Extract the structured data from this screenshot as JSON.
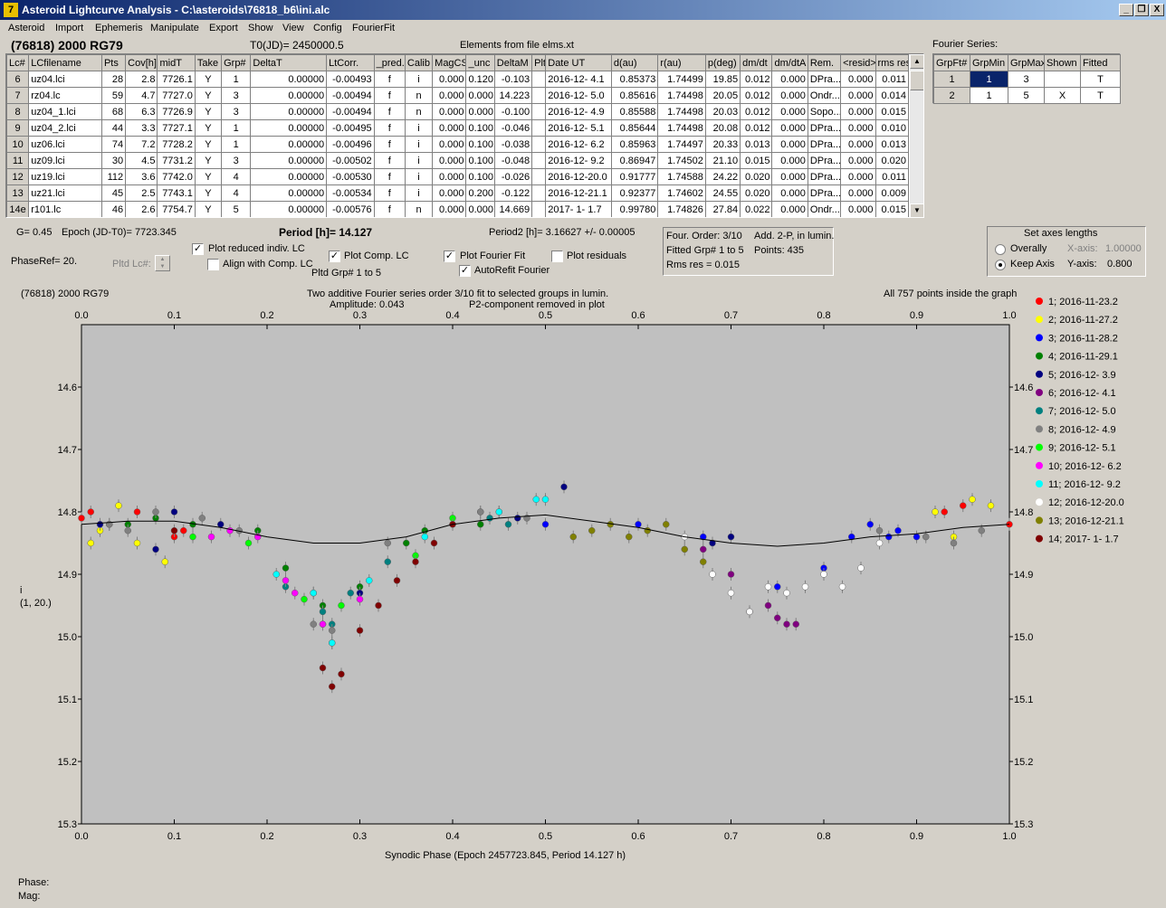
{
  "window": {
    "title": "Asteroid Lightcurve Analysis - C:\\asteroids\\76818_b6\\ini.alc",
    "min": "_",
    "restore": "❐",
    "close": "X"
  },
  "menu": [
    "Asteroid",
    "Import",
    "Ephemeris",
    "Manipulate",
    "Export",
    "Show",
    "View",
    "Config",
    "FourierFit"
  ],
  "header": {
    "object": "(76818) 2000 RG79",
    "t0": "T0(JD)= 2450000.5",
    "elements": "Elements from file elms.xt",
    "fourier_label": "Fourier Series:"
  },
  "lc_table": {
    "columns": [
      "Lc#",
      "LCfilename",
      "Pts",
      "Cov[h]",
      "midT",
      "Take",
      "Grp#",
      "DeltaT",
      "LtCorr.",
      "_pred.",
      "Calib",
      "MagCS",
      "_unc",
      "DeltaM",
      "Plt",
      "Date UT",
      "d(au)",
      "r(au)",
      "p(deg)",
      "dm/dt",
      "dm/dtA",
      "Rem.",
      "<resid>",
      "rms res"
    ],
    "rows": [
      [
        "6",
        "uz04.lci",
        "28",
        "2.8",
        "7726.1",
        "Y",
        "1",
        "0.00000",
        "-0.00493",
        "f",
        "i",
        "0.000",
        "0.120",
        "-0.103",
        "",
        "2016-12- 4.1",
        "0.85373",
        "1.74499",
        "19.85",
        "0.012",
        "0.000",
        "DPra...",
        "0.000",
        "0.011"
      ],
      [
        "7",
        "rz04.lc",
        "59",
        "4.7",
        "7727.0",
        "Y",
        "3",
        "0.00000",
        "-0.00494",
        "f",
        "n",
        "0.000",
        "0.000",
        "14.223",
        "",
        "2016-12- 5.0",
        "0.85616",
        "1.74498",
        "20.05",
        "0.012",
        "0.000",
        "Ondr...",
        "0.000",
        "0.014"
      ],
      [
        "8",
        "uz04_1.lci",
        "68",
        "6.3",
        "7726.9",
        "Y",
        "3",
        "0.00000",
        "-0.00494",
        "f",
        "n",
        "0.000",
        "0.000",
        "-0.100",
        "",
        "2016-12- 4.9",
        "0.85588",
        "1.74498",
        "20.03",
        "0.012",
        "0.000",
        "Sopo...",
        "0.000",
        "0.015"
      ],
      [
        "9",
        "uz04_2.lci",
        "44",
        "3.3",
        "7727.1",
        "Y",
        "1",
        "0.00000",
        "-0.00495",
        "f",
        "i",
        "0.000",
        "0.100",
        "-0.046",
        "",
        "2016-12- 5.1",
        "0.85644",
        "1.74498",
        "20.08",
        "0.012",
        "0.000",
        "DPra...",
        "0.000",
        "0.010"
      ],
      [
        "10",
        "uz06.lci",
        "74",
        "7.2",
        "7728.2",
        "Y",
        "1",
        "0.00000",
        "-0.00496",
        "f",
        "i",
        "0.000",
        "0.100",
        "-0.038",
        "",
        "2016-12- 6.2",
        "0.85963",
        "1.74497",
        "20.33",
        "0.013",
        "0.000",
        "DPra...",
        "0.000",
        "0.013"
      ],
      [
        "11",
        "uz09.lci",
        "30",
        "4.5",
        "7731.2",
        "Y",
        "3",
        "0.00000",
        "-0.00502",
        "f",
        "i",
        "0.000",
        "0.100",
        "-0.048",
        "",
        "2016-12- 9.2",
        "0.86947",
        "1.74502",
        "21.10",
        "0.015",
        "0.000",
        "DPra...",
        "0.000",
        "0.020"
      ],
      [
        "12",
        "uz19.lci",
        "112",
        "3.6",
        "7742.0",
        "Y",
        "4",
        "0.00000",
        "-0.00530",
        "f",
        "i",
        "0.000",
        "0.100",
        "-0.026",
        "",
        "2016-12-20.0",
        "0.91777",
        "1.74588",
        "24.22",
        "0.020",
        "0.000",
        "DPra...",
        "0.000",
        "0.011"
      ],
      [
        "13",
        "uz21.lci",
        "45",
        "2.5",
        "7743.1",
        "Y",
        "4",
        "0.00000",
        "-0.00534",
        "f",
        "i",
        "0.000",
        "0.200",
        "-0.122",
        "",
        "2016-12-21.1",
        "0.92377",
        "1.74602",
        "24.55",
        "0.020",
        "0.000",
        "DPra...",
        "0.000",
        "0.009"
      ],
      [
        "14e",
        "r101.lc",
        "46",
        "2.6",
        "7754.7",
        "Y",
        "5",
        "0.00000",
        "-0.00576",
        "f",
        "n",
        "0.000",
        "0.000",
        "14.669",
        "",
        "2017- 1- 1.7",
        "0.99780",
        "1.74826",
        "27.84",
        "0.022",
        "0.000",
        "Ondr...",
        "0.000",
        "0.015"
      ]
    ]
  },
  "fourier_table": {
    "columns": [
      "GrpFt#",
      "GrpMin",
      "GrpMax",
      "Shown",
      "Fitted"
    ],
    "rows": [
      [
        "1",
        "1",
        "3",
        "",
        "T"
      ],
      [
        "2",
        "1",
        "5",
        "X",
        "T"
      ]
    ]
  },
  "controls": {
    "g": "G= 0.45",
    "epoch": "Epoch (JD-T0)= 7723.345",
    "period": "Period [h]= 14.127",
    "period2": "Period2 [h]= 3.16627 +/- 0.00005",
    "phaseref": "PhaseRef= 20.",
    "pltd_lc": "Pltd Lc#:",
    "plot_reduced": "Plot reduced indiv. LC",
    "align_comp": "Align with Comp. LC",
    "plot_comp": "Plot Comp. LC",
    "pltd_grp": "Pltd Grp#  1   to   5",
    "plot_fourier": "Plot Fourier Fit",
    "autorefit": "AutoRefit Fourier",
    "plot_residuals": "Plot residuals",
    "info1a": "Four. Order:  3/10",
    "info1b": "Add. 2-P, in lumin.",
    "info2a": "Fitted Grp# 1 to 5",
    "info2b": "Points: 435",
    "info3": "Rms res     = 0.015",
    "axes_title": "Set axes lengths",
    "overally": "Overally",
    "keep_axis": "Keep Axis",
    "xaxis_lbl": "X-axis:",
    "xaxis_val": "1.00000",
    "yaxis_lbl": "Y-axis:",
    "yaxis_val": "0.800"
  },
  "plot": {
    "object": "(76818) 2000 RG79",
    "title1": "Two additive Fourier series order 3/10 fit to selected groups in lumin.",
    "title2": "Amplitude: 0.043",
    "title3": "P2-component removed in plot",
    "points_note": "All 757 points inside the graph",
    "ylabel1": "i",
    "ylabel2": "(1, 20.)",
    "xlabel": "Synodic Phase (Epoch 2457723.845, Period 14.127 h)"
  },
  "status": {
    "phase": "Phase:",
    "mag": "Mag:"
  },
  "colors": {
    "panel": "#d4d0c8",
    "plot_bg": "#c0c0c0",
    "selected": "#0a246a"
  },
  "chart_data": {
    "type": "scatter",
    "xlabel": "Synodic Phase (Epoch 2457723.845, Period 14.127 h)",
    "ylabel": "i",
    "xlim": [
      0.0,
      1.0
    ],
    "ylim": [
      15.3,
      14.5
    ],
    "xticks": [
      "0.0",
      "0.1",
      "0.2",
      "0.3",
      "0.4",
      "0.5",
      "0.6",
      "0.7",
      "0.8",
      "0.9",
      "1.0"
    ],
    "yticks": [
      "14.6",
      "14.7",
      "14.8",
      "14.9",
      "15.0",
      "15.1",
      "15.2",
      "15.3"
    ],
    "fourier_fit": {
      "x": [
        0.0,
        0.05,
        0.1,
        0.15,
        0.2,
        0.25,
        0.3,
        0.35,
        0.4,
        0.45,
        0.5,
        0.55,
        0.6,
        0.65,
        0.7,
        0.75,
        0.8,
        0.85,
        0.9,
        0.95,
        1.0
      ],
      "y": [
        14.82,
        14.815,
        14.815,
        14.825,
        14.84,
        14.85,
        14.85,
        14.84,
        14.82,
        14.81,
        14.805,
        14.815,
        14.825,
        14.84,
        14.85,
        14.855,
        14.85,
        14.84,
        14.835,
        14.825,
        14.82
      ]
    },
    "series": [
      {
        "name": "1; 2016-11-23.2",
        "color": "#ff0000",
        "x": [
          0.0,
          0.01,
          0.03,
          0.06,
          0.1,
          0.11,
          1.0,
          0.95,
          0.93
        ],
        "y": [
          14.81,
          14.8,
          14.82,
          14.8,
          14.84,
          14.83,
          14.82,
          14.79,
          14.8
        ]
      },
      {
        "name": "2; 2016-11-27.2",
        "color": "#ffff00",
        "x": [
          0.01,
          0.02,
          0.04,
          0.06,
          0.09,
          0.92,
          0.94,
          0.96,
          0.98
        ],
        "y": [
          14.85,
          14.83,
          14.79,
          14.85,
          14.88,
          14.8,
          14.84,
          14.78,
          14.79
        ]
      },
      {
        "name": "3; 2016-11-28.2",
        "color": "#0000ff",
        "x": [
          0.45,
          0.5,
          0.6,
          0.67,
          0.75,
          0.8,
          0.83,
          0.85,
          0.87,
          0.88,
          0.9
        ],
        "y": [
          14.8,
          14.82,
          14.82,
          14.84,
          14.92,
          14.89,
          14.84,
          14.82,
          14.84,
          14.83,
          14.84
        ]
      },
      {
        "name": "4; 2016-11-29.1",
        "color": "#008000",
        "x": [
          0.05,
          0.08,
          0.12,
          0.19,
          0.22,
          0.26,
          0.3,
          0.35,
          0.37,
          0.43
        ],
        "y": [
          14.82,
          14.81,
          14.82,
          14.83,
          14.89,
          14.95,
          14.92,
          14.85,
          14.83,
          14.82
        ]
      },
      {
        "name": "5; 2016-12- 3.9",
        "color": "#000080",
        "x": [
          0.02,
          0.08,
          0.1,
          0.15,
          0.27,
          0.3,
          0.4,
          0.43,
          0.47,
          0.52,
          0.68,
          0.7
        ],
        "y": [
          14.82,
          14.86,
          14.8,
          14.82,
          15.01,
          14.93,
          14.82,
          14.8,
          14.81,
          14.76,
          14.85,
          14.84
        ]
      },
      {
        "name": "6; 2016-12- 4.1",
        "color": "#800080",
        "x": [
          0.67,
          0.7,
          0.72,
          0.74,
          0.75,
          0.76,
          0.77
        ],
        "y": [
          14.86,
          14.9,
          14.96,
          14.95,
          14.97,
          14.98,
          14.98
        ]
      },
      {
        "name": "7; 2016-12- 5.0",
        "color": "#008080",
        "x": [
          0.22,
          0.26,
          0.27,
          0.29,
          0.33,
          0.44,
          0.46
        ],
        "y": [
          14.92,
          14.96,
          14.98,
          14.93,
          14.88,
          14.81,
          14.82
        ]
      },
      {
        "name": "8; 2016-12- 4.9",
        "color": "#808080",
        "x": [
          0.03,
          0.05,
          0.08,
          0.13,
          0.17,
          0.25,
          0.27,
          0.33,
          0.43,
          0.48,
          0.86,
          0.91,
          0.94,
          0.97
        ],
        "y": [
          14.82,
          14.83,
          14.8,
          14.81,
          14.83,
          14.98,
          14.99,
          14.85,
          14.8,
          14.81,
          14.83,
          14.84,
          14.85,
          14.83
        ]
      },
      {
        "name": "9; 2016-12- 5.1",
        "color": "#00ff00",
        "x": [
          0.12,
          0.18,
          0.24,
          0.26,
          0.28,
          0.36,
          0.4
        ],
        "y": [
          14.84,
          14.85,
          14.94,
          14.98,
          14.95,
          14.87,
          14.81
        ]
      },
      {
        "name": "10; 2016-12- 6.2",
        "color": "#ff00ff",
        "x": [
          0.14,
          0.16,
          0.19,
          0.22,
          0.23,
          0.25,
          0.26,
          0.3
        ],
        "y": [
          14.84,
          14.83,
          14.84,
          14.91,
          14.93,
          14.93,
          14.98,
          14.94
        ]
      },
      {
        "name": "11; 2016-12- 9.2",
        "color": "#00ffff",
        "x": [
          0.21,
          0.25,
          0.27,
          0.31,
          0.37,
          0.45,
          0.49,
          0.5
        ],
        "y": [
          14.9,
          14.93,
          15.01,
          14.91,
          14.84,
          14.8,
          14.78,
          14.78
        ]
      },
      {
        "name": "12; 2016-12-20.0",
        "color": "#ffffff",
        "x": [
          0.65,
          0.68,
          0.7,
          0.72,
          0.74,
          0.76,
          0.78,
          0.8,
          0.82,
          0.84,
          0.86
        ],
        "y": [
          14.84,
          14.9,
          14.93,
          14.96,
          14.92,
          14.93,
          14.92,
          14.9,
          14.92,
          14.89,
          14.85
        ]
      },
      {
        "name": "13; 2016-12-21.1",
        "color": "#808000",
        "x": [
          0.53,
          0.55,
          0.57,
          0.59,
          0.61,
          0.63,
          0.65,
          0.67
        ],
        "y": [
          14.84,
          14.83,
          14.82,
          14.84,
          14.83,
          14.82,
          14.86,
          14.88
        ]
      },
      {
        "name": "14; 2017- 1- 1.7",
        "color": "#800000",
        "x": [
          0.1,
          0.26,
          0.27,
          0.28,
          0.3,
          0.32,
          0.34,
          0.36,
          0.38,
          0.4
        ],
        "y": [
          14.83,
          15.05,
          15.08,
          15.06,
          14.99,
          14.95,
          14.91,
          14.88,
          14.85,
          14.82
        ]
      }
    ]
  }
}
